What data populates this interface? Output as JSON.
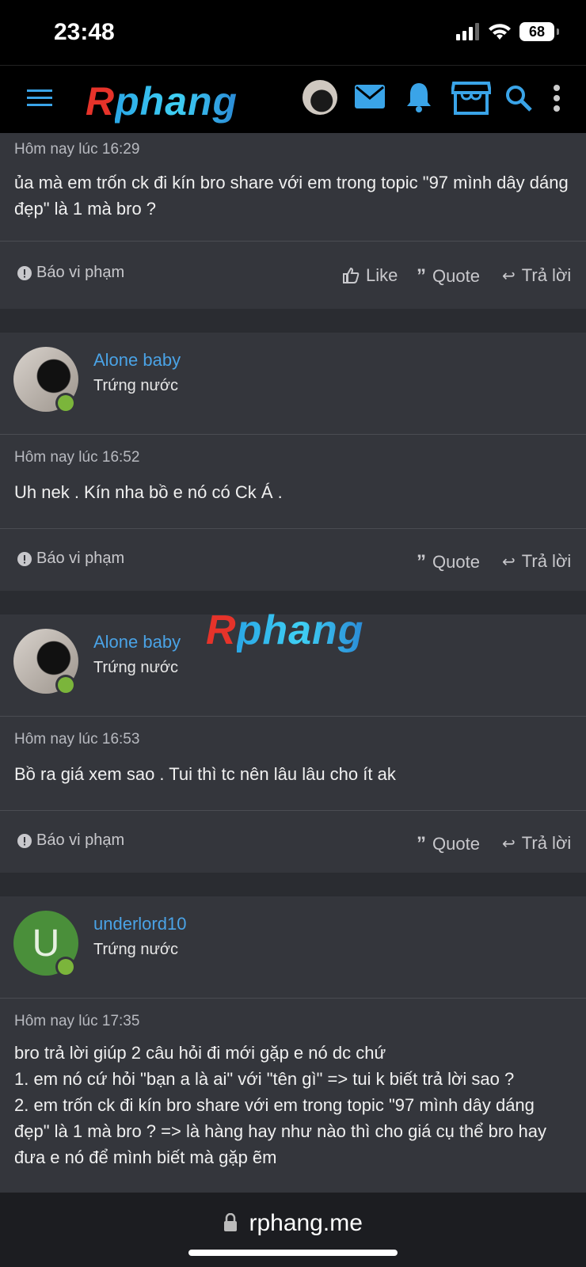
{
  "status_bar": {
    "time": "23:48",
    "battery": "68"
  },
  "nav": {
    "logo_r": "R",
    "logo_rest": "phang"
  },
  "watermark": {
    "r": "R",
    "rest": "phang"
  },
  "posts": [
    {
      "date": "Hôm nay lúc 16:29",
      "text": "ủa mà em trốn ck đi kín bro share với em trong topic \"97 mình dây dáng đẹp\" là 1 mà bro ?",
      "report": "Báo vi phạm",
      "like": "Like",
      "quote": "Quote",
      "reply": "Trả lời"
    },
    {
      "username": "Alone baby",
      "user_title": "Trứng nước",
      "date": "Hôm nay lúc 16:52",
      "text": "Uh nek . Kín nha bồ e nó có Ck Á .",
      "report": "Báo vi phạm",
      "quote": "Quote",
      "reply": "Trả lời"
    },
    {
      "username": "Alone baby",
      "user_title": "Trứng nước",
      "date": "Hôm nay lúc 16:53",
      "text": "Bồ ra giá xem sao . Tui thì tc nên lâu lâu cho ít ak",
      "report": "Báo vi phạm",
      "quote": "Quote",
      "reply": "Trả lời"
    },
    {
      "username": "underlord10",
      "user_title": "Trứng nước",
      "avatar_letter": "U",
      "date": "Hôm nay lúc 17:35",
      "lines": [
        "bro trả lời giúp 2 câu hỏi đi mới gặp e nó dc chứ",
        "1. em nó cứ hỏi \"bạn a là ai\" với \"tên gì\" => tui k biết trả lời sao ?",
        "2. em trốn ck đi kín bro share với em trong topic \"97 mình dây dáng đẹp\" là 1 mà bro ? => là hàng hay như nào thì cho giá cụ thể bro hay đưa e nó để mình biết mà gặp ẽm"
      ]
    }
  ],
  "browser": {
    "url": "rphang.me"
  },
  "colors": {
    "accent": "#4aa3e6",
    "online": "#7bb53b",
    "card": "#34363c",
    "bg": "#2a2c31"
  }
}
